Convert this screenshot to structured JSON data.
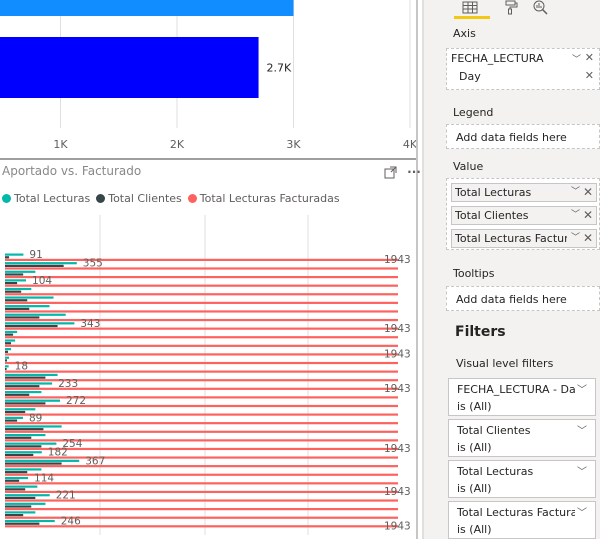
{
  "top_chart": {
    "x_ticks": [
      "1K",
      "2K",
      "3K",
      "4K"
    ],
    "bars": [
      {
        "value": 3000,
        "label": "",
        "color": "#118dff"
      },
      {
        "value": 2700,
        "label": "2.7K",
        "color": "#0000ff"
      }
    ],
    "x_max": 4000
  },
  "visual": {
    "title": "Aportado vs. Facturado",
    "focus_icon": "focus-mode-icon",
    "more_icon": "more-options-icon",
    "more_glyph": "···"
  },
  "chart_data": {
    "type": "bar",
    "orientation": "horizontal",
    "series": [
      {
        "name": "Total Lecturas",
        "color": "#01b8aa"
      },
      {
        "name": "Total Clientes",
        "color": "#374649"
      },
      {
        "name": "Total Lecturas Facturadas",
        "color": "#fd625e"
      }
    ],
    "rows": [
      {
        "lecturas": 91,
        "clientes": 20,
        "facturadas": 1943,
        "lecturas_label": "91",
        "facturadas_label": "1943"
      },
      {
        "lecturas": 355,
        "clientes": 290,
        "facturadas": 1943,
        "lecturas_label": "355",
        "facturadas_label": ""
      },
      {
        "lecturas": 150,
        "clientes": 90,
        "facturadas": 1943,
        "lecturas_label": "",
        "facturadas_label": ""
      },
      {
        "lecturas": 104,
        "clientes": 60,
        "facturadas": 1943,
        "lecturas_label": "104",
        "facturadas_label": ""
      },
      {
        "lecturas": 130,
        "clientes": 80,
        "facturadas": 1943,
        "lecturas_label": "",
        "facturadas_label": ""
      },
      {
        "lecturas": 240,
        "clientes": 110,
        "facturadas": 1943,
        "lecturas_label": "",
        "facturadas_label": ""
      },
      {
        "lecturas": 220,
        "clientes": 120,
        "facturadas": 1943,
        "lecturas_label": "",
        "facturadas_label": ""
      },
      {
        "lecturas": 300,
        "clientes": 170,
        "facturadas": 1943,
        "lecturas_label": "",
        "facturadas_label": ""
      },
      {
        "lecturas": 343,
        "clientes": 260,
        "facturadas": 1943,
        "lecturas_label": "343",
        "facturadas_label": "1943"
      },
      {
        "lecturas": 60,
        "clientes": 40,
        "facturadas": 1943,
        "lecturas_label": "",
        "facturadas_label": ""
      },
      {
        "lecturas": 50,
        "clientes": 30,
        "facturadas": 1943,
        "lecturas_label": "",
        "facturadas_label": ""
      },
      {
        "lecturas": 30,
        "clientes": 15,
        "facturadas": 1943,
        "lecturas_label": "",
        "facturadas_label": "1943"
      },
      {
        "lecturas": 20,
        "clientes": 10,
        "facturadas": 1943,
        "lecturas_label": "",
        "facturadas_label": ""
      },
      {
        "lecturas": 18,
        "clientes": 8,
        "facturadas": 1943,
        "lecturas_label": "18",
        "facturadas_label": ""
      },
      {
        "lecturas": 260,
        "clientes": 200,
        "facturadas": 1943,
        "lecturas_label": "",
        "facturadas_label": ""
      },
      {
        "lecturas": 233,
        "clientes": 170,
        "facturadas": 1943,
        "lecturas_label": "233",
        "facturadas_label": "1943"
      },
      {
        "lecturas": 180,
        "clientes": 120,
        "facturadas": 1943,
        "lecturas_label": "",
        "facturadas_label": ""
      },
      {
        "lecturas": 272,
        "clientes": 200,
        "facturadas": 1943,
        "lecturas_label": "272",
        "facturadas_label": ""
      },
      {
        "lecturas": 150,
        "clientes": 100,
        "facturadas": 1943,
        "lecturas_label": "",
        "facturadas_label": ""
      },
      {
        "lecturas": 89,
        "clientes": 60,
        "facturadas": 1943,
        "lecturas_label": "89",
        "facturadas_label": ""
      },
      {
        "lecturas": 280,
        "clientes": 190,
        "facturadas": 1943,
        "lecturas_label": "",
        "facturadas_label": ""
      },
      {
        "lecturas": 200,
        "clientes": 130,
        "facturadas": 1943,
        "lecturas_label": "",
        "facturadas_label": ""
      },
      {
        "lecturas": 254,
        "clientes": 180,
        "facturadas": 1943,
        "lecturas_label": "254",
        "facturadas_label": "1943"
      },
      {
        "lecturas": 182,
        "clientes": 140,
        "facturadas": 1943,
        "lecturas_label": "182",
        "facturadas_label": ""
      },
      {
        "lecturas": 367,
        "clientes": 280,
        "facturadas": 1943,
        "lecturas_label": "367",
        "facturadas_label": ""
      },
      {
        "lecturas": 180,
        "clientes": 110,
        "facturadas": 1943,
        "lecturas_label": "",
        "facturadas_label": ""
      },
      {
        "lecturas": 114,
        "clientes": 70,
        "facturadas": 1943,
        "lecturas_label": "114",
        "facturadas_label": ""
      },
      {
        "lecturas": 160,
        "clientes": 100,
        "facturadas": 1943,
        "lecturas_label": "",
        "facturadas_label": "1943"
      },
      {
        "lecturas": 221,
        "clientes": 150,
        "facturadas": 1943,
        "lecturas_label": "221",
        "facturadas_label": ""
      },
      {
        "lecturas": 200,
        "clientes": 130,
        "facturadas": 1943,
        "lecturas_label": "",
        "facturadas_label": ""
      },
      {
        "lecturas": 150,
        "clientes": 90,
        "facturadas": 1943,
        "lecturas_label": "",
        "facturadas_label": ""
      },
      {
        "lecturas": 246,
        "clientes": 170,
        "facturadas": 1943,
        "lecturas_label": "246",
        "facturadas_label": "1943"
      }
    ],
    "x_max": 1943,
    "grid": true,
    "legend_position": "top-left"
  },
  "pane": {
    "tabs": [
      {
        "name": "fields-tab",
        "icon": "table-grid-icon",
        "active": true
      },
      {
        "name": "format-tab",
        "icon": "paint-roller-icon",
        "active": false
      },
      {
        "name": "analytics-tab",
        "icon": "magnifier-chart-icon",
        "active": false
      }
    ],
    "axis_label": "Axis",
    "axis_fields": [
      "FECHA_LECTURA",
      "Day"
    ],
    "legend_label": "Legend",
    "legend_placeholder": "Add data fields here",
    "value_label": "Value",
    "value_fields": [
      "Total Lecturas",
      "Total Clientes",
      "Total Lecturas Facturadas"
    ],
    "tooltips_label": "Tooltips",
    "tooltips_placeholder": "Add data fields here",
    "filters_title": "Filters",
    "visual_level_label": "Visual level filters",
    "filters": [
      {
        "name": "FECHA_LECTURA - Day",
        "state": "is (All)"
      },
      {
        "name": "Total Clientes",
        "state": "is (All)"
      },
      {
        "name": "Total Lecturas",
        "state": "is (All)"
      },
      {
        "name": "Total Lecturas Facturadas",
        "state": "is (All)"
      }
    ],
    "glyphs": {
      "chevron": "﹀",
      "close": "✕"
    }
  }
}
